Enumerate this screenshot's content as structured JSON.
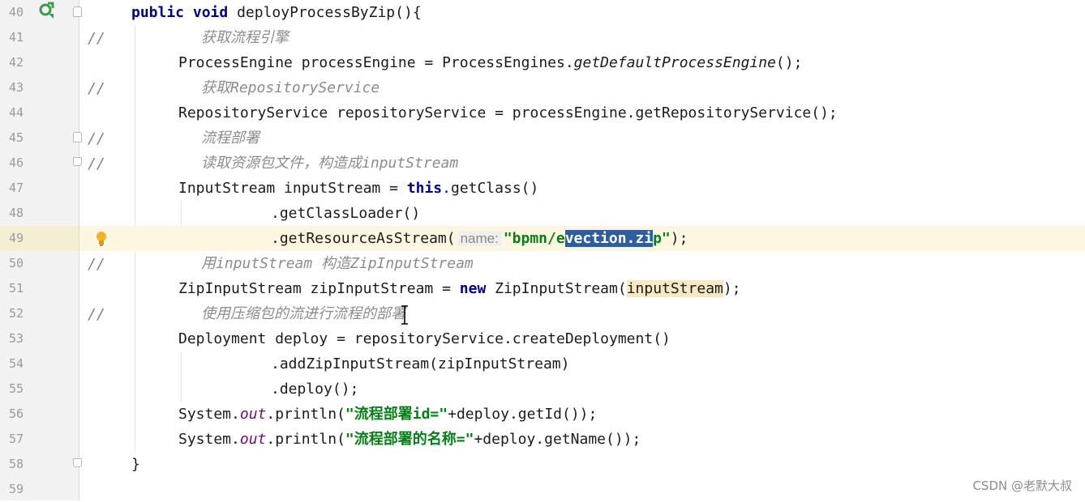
{
  "editor": {
    "lines": [
      {
        "n": "40"
      },
      {
        "n": "41"
      },
      {
        "n": "42"
      },
      {
        "n": "43"
      },
      {
        "n": "44"
      },
      {
        "n": "45"
      },
      {
        "n": "46"
      },
      {
        "n": "47"
      },
      {
        "n": "48"
      },
      {
        "n": "49"
      },
      {
        "n": "50"
      },
      {
        "n": "51"
      },
      {
        "n": "52"
      },
      {
        "n": "53"
      },
      {
        "n": "54"
      },
      {
        "n": "55"
      },
      {
        "n": "56"
      },
      {
        "n": "57"
      },
      {
        "n": "58"
      },
      {
        "n": "59"
      }
    ],
    "line_comment_marker": "//",
    "code": {
      "l40": {
        "kw1": "public",
        "kw2": "void",
        "rest": "deployProcessByZip(){"
      },
      "l41": {
        "comment": "获取流程引擎"
      },
      "l42": {
        "pre": "ProcessEngine processEngine = ProcessEngines.",
        "static": "getDefaultProcessEngine",
        "post": "();"
      },
      "l43": {
        "comment": "获取RepositoryService"
      },
      "l44": {
        "text": "RepositoryService repositoryService = processEngine.getRepositoryService();"
      },
      "l45": {
        "comment": "流程部署"
      },
      "l46": {
        "comment": "读取资源包文件，构造成inputStream"
      },
      "l47": {
        "pre": "InputStream inputStream = ",
        "kw": "this",
        "post": ".getClass()"
      },
      "l48": {
        "text": ".getClassLoader()"
      },
      "l49": {
        "pre": ".getResourceAsStream(",
        "hint": "name:",
        "str_a": "\"bpmn/e",
        "str_sel": "vection.zi",
        "str_b": "p\"",
        "post": ");"
      },
      "l50": {
        "comment": "用inputStream 构造ZipInputStream"
      },
      "l51": {
        "pre": "ZipInputStream zipInputStream = ",
        "kw": "new",
        "mid": " ZipInputStream(",
        "ident": "inputStream",
        "post": ");"
      },
      "l52": {
        "comment": "使用压缩包的流进行流程的部署"
      },
      "l53": {
        "text": "Deployment deploy = repositoryService.createDeployment()"
      },
      "l54": {
        "text": ".addZipInputStream(zipInputStream)"
      },
      "l55": {
        "text": ".deploy();"
      },
      "l56": {
        "pre": "System.",
        "field": "out",
        "mid": ".println(",
        "str": "\"流程部署id=\"",
        "post": "+deploy.getId());"
      },
      "l57": {
        "pre": "System.",
        "field": "out",
        "mid": ".println(",
        "str": "\"流程部署的名称=\"",
        "post": "+deploy.getName());"
      },
      "l58": {
        "text": "}"
      }
    }
  },
  "watermark": "CSDN @老默大叔",
  "colors": {
    "keyword": "#000080",
    "string": "#067d17",
    "comment": "#8c8c8c",
    "selection": "#2f5e9c",
    "current_line": "#fdf7e1"
  }
}
